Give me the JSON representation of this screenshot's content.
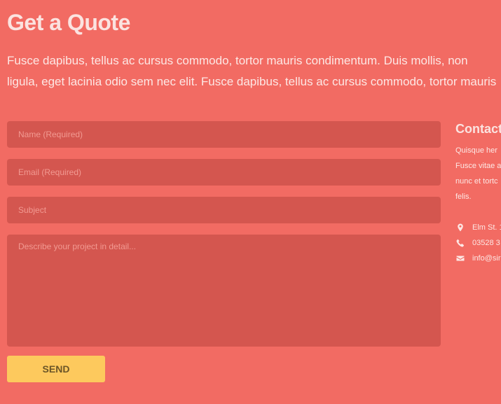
{
  "quote": {
    "title": "Get a Quote",
    "intro_lines": [
      "Fusce dapibus, tellus ac cursus commodo, tortor mauris condimentum. Duis mollis, non",
      "ligula, eget lacinia odio sem nec elit. Fusce dapibus, tellus ac cursus commodo, tortor mauris"
    ]
  },
  "form": {
    "name_placeholder": "Name (Required)",
    "email_placeholder": "Email (Required)",
    "subject_placeholder": "Subject",
    "message_placeholder": "Describe your project in detail...",
    "send_label": "SEND"
  },
  "contact": {
    "title": "Contact",
    "text_lines": [
      "Quisque her",
      "Fusce vitae a",
      "nunc et tortc",
      "felis."
    ],
    "items": [
      {
        "icon": "map-pin-icon",
        "text": "Elm St. 1"
      },
      {
        "icon": "phone-icon",
        "text": "03528 3"
      },
      {
        "icon": "envelope-icon",
        "text": "info@sir"
      }
    ]
  },
  "colors": {
    "background": "#f26b63",
    "field": "#d4564f",
    "button": "#fdc95d",
    "button_text": "#6b5528"
  }
}
